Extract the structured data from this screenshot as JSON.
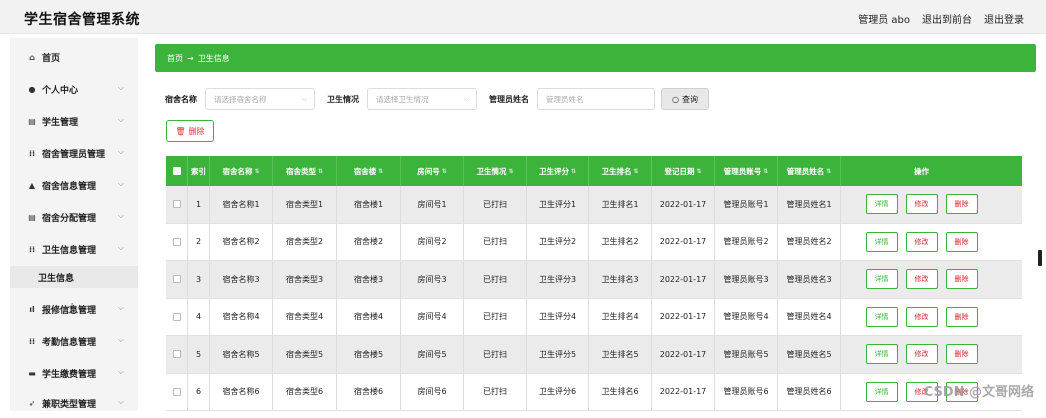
{
  "app": {
    "title": "学生宿舍管理系统"
  },
  "topbar": {
    "user": "管理员 abo",
    "to_front": "退出到前台",
    "logout": "退出登录"
  },
  "sidebar": {
    "items": [
      {
        "label": "首页",
        "icon": "home-icon",
        "glyph": "⌂",
        "has_chevron": false
      },
      {
        "label": "个人中心",
        "icon": "user-icon",
        "glyph": "●",
        "has_chevron": true
      },
      {
        "label": "学生管理",
        "icon": "doc-icon",
        "glyph": "▤",
        "has_chevron": true
      },
      {
        "label": "宿舍管理员管理",
        "icon": "grid-icon",
        "glyph": "⁞⁞",
        "has_chevron": true
      },
      {
        "label": "宿舍信息管理",
        "icon": "home-icon",
        "glyph": "▲",
        "has_chevron": true
      },
      {
        "label": "宿舍分配管理",
        "icon": "doc-icon",
        "glyph": "▤",
        "has_chevron": true
      },
      {
        "label": "卫生信息管理",
        "icon": "grid-icon",
        "glyph": "⁞⁞",
        "has_chevron": true
      },
      {
        "label": "报修信息管理",
        "icon": "chart-icon",
        "glyph": "ıl",
        "has_chevron": true
      },
      {
        "label": "考勤信息管理",
        "icon": "grid-icon",
        "glyph": "⁞⁞",
        "has_chevron": true
      },
      {
        "label": "学生缴费管理",
        "icon": "card-icon",
        "glyph": "▬",
        "has_chevron": true
      },
      {
        "label": "兼职类型管理",
        "icon": "send-icon",
        "glyph": "➶",
        "has_chevron": true
      }
    ],
    "sub_item": "卫生信息"
  },
  "breadcrumb": {
    "home": "首页",
    "arrow": "→",
    "current": "卫生信息"
  },
  "filters": {
    "dorm_name_label": "宿舍名称",
    "dorm_name_placeholder": "请选择宿舍名称",
    "hygiene_label": "卫生情况",
    "hygiene_placeholder": "请选择卫生情况",
    "admin_label": "管理员姓名",
    "admin_placeholder": "管理员姓名",
    "search_button": "查询"
  },
  "actions": {
    "delete_button": "删除"
  },
  "table": {
    "headers": [
      "索引",
      "宿舍名称",
      "宿舍类型",
      "宿舍楼",
      "房间号",
      "卫生情况",
      "卫生评分",
      "卫生排名",
      "登记日期",
      "管理员账号",
      "管理员姓名",
      "操作"
    ],
    "rows": [
      [
        "1",
        "宿舍名称1",
        "宿舍类型1",
        "宿舍楼1",
        "房间号1",
        "已打扫",
        "卫生评分1",
        "卫生排名1",
        "2022-01-17",
        "管理员账号1",
        "管理员姓名1"
      ],
      [
        "2",
        "宿舍名称2",
        "宿舍类型2",
        "宿舍楼2",
        "房间号2",
        "已打扫",
        "卫生评分2",
        "卫生排名2",
        "2022-01-17",
        "管理员账号2",
        "管理员姓名2"
      ],
      [
        "3",
        "宿舍名称3",
        "宿舍类型3",
        "宿舍楼3",
        "房间号3",
        "已打扫",
        "卫生评分3",
        "卫生排名3",
        "2022-01-17",
        "管理员账号3",
        "管理员姓名3"
      ],
      [
        "4",
        "宿舍名称4",
        "宿舍类型4",
        "宿舍楼4",
        "房间号4",
        "已打扫",
        "卫生评分4",
        "卫生排名4",
        "2022-01-17",
        "管理员账号4",
        "管理员姓名4"
      ],
      [
        "5",
        "宿舍名称5",
        "宿舍类型5",
        "宿舍楼5",
        "房间号5",
        "已打扫",
        "卫生评分5",
        "卫生排名5",
        "2022-01-17",
        "管理员账号5",
        "管理员姓名5"
      ],
      [
        "6",
        "宿舍名称6",
        "宿舍类型6",
        "宿舍楼6",
        "房间号6",
        "已打扫",
        "卫生评分6",
        "卫生排名6",
        "2022-01-17",
        "管理员账号6",
        "管理员姓名6"
      ]
    ],
    "row_actions": {
      "detail": "详情",
      "edit": "修改",
      "delete": "删除"
    }
  },
  "watermark": "CSDN @文哥网络",
  "colors": {
    "accent": "#3cb43c",
    "danger": "#d02a2a"
  }
}
